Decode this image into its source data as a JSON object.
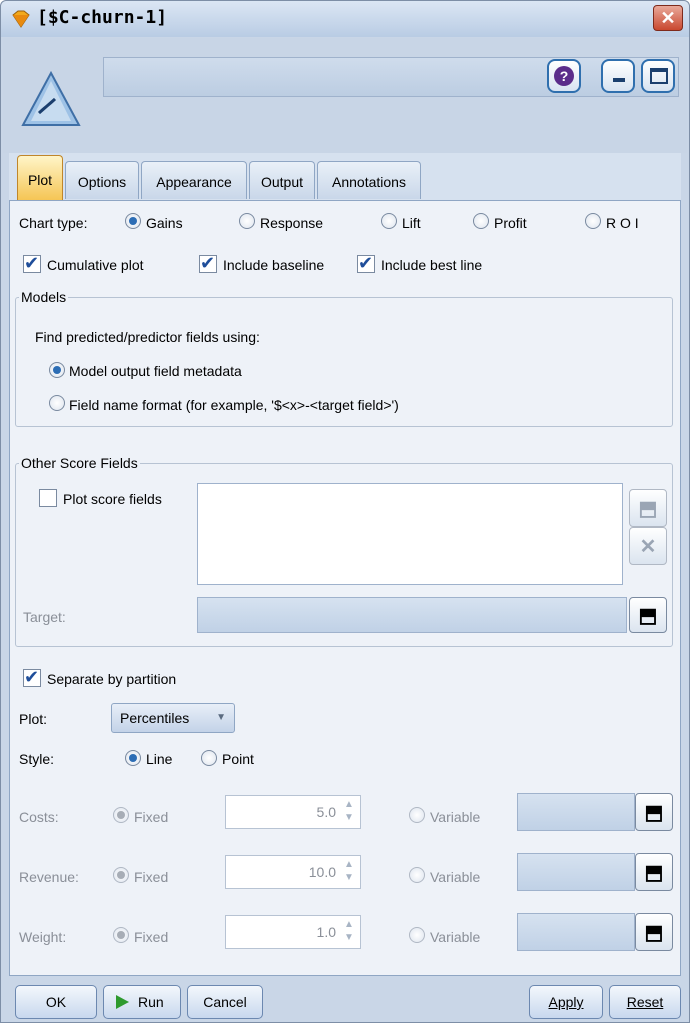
{
  "window": {
    "title": "[$C-churn-1]",
    "close_glyph": "✕"
  },
  "header": {
    "name_value": "",
    "help_glyph": "?"
  },
  "tabs": [
    {
      "label": "Plot"
    },
    {
      "label": "Options"
    },
    {
      "label": "Appearance"
    },
    {
      "label": "Output"
    },
    {
      "label": "Annotations"
    }
  ],
  "chart_type": {
    "label": "Chart type:",
    "options": [
      {
        "label": "Gains",
        "selected": true
      },
      {
        "label": "Response",
        "selected": false
      },
      {
        "label": "Lift",
        "selected": false
      },
      {
        "label": "Profit",
        "selected": false
      },
      {
        "label": "R O I",
        "selected": false
      }
    ]
  },
  "plot_checks": [
    {
      "label": "Cumulative plot",
      "checked": true
    },
    {
      "label": "Include baseline",
      "checked": true
    },
    {
      "label": "Include best line",
      "checked": true
    }
  ],
  "models": {
    "legend": "Models",
    "prompt": "Find predicted/predictor fields using:",
    "options": [
      {
        "label": "Model output field metadata",
        "selected": true
      },
      {
        "label": "Field name format (for example, '$<x>-<target field>')",
        "selected": false
      }
    ]
  },
  "other_scores": {
    "legend": "Other Score Fields",
    "plot_label": "Plot score fields",
    "plot_checked": false,
    "target_label": "Target:",
    "delete_glyph": "✕"
  },
  "separate": {
    "label": "Separate by partition",
    "checked": true
  },
  "plot_select": {
    "label": "Plot:",
    "value": "Percentiles",
    "caret": "▼"
  },
  "style": {
    "label": "Style:",
    "options": [
      {
        "label": "Line",
        "selected": true
      },
      {
        "label": "Point",
        "selected": false
      }
    ]
  },
  "costs_rows": [
    {
      "label": "Costs:",
      "fixed_label": "Fixed",
      "value": "5.0",
      "variable_label": "Variable"
    },
    {
      "label": "Revenue:",
      "fixed_label": "Fixed",
      "value": "10.0",
      "variable_label": "Variable"
    },
    {
      "label": "Weight:",
      "fixed_label": "Fixed",
      "value": "1.0",
      "variable_label": "Variable"
    }
  ],
  "spin_up": "▲",
  "spin_down": "▼",
  "field_picker_glyph": "⬒",
  "buttons": {
    "ok": "OK",
    "run": "Run",
    "cancel": "Cancel",
    "apply": "Apply",
    "reset": "Reset"
  },
  "colors": {
    "accent": "#2c6db5",
    "active_tab": "#f5c452",
    "run_green": "#2e9a2e"
  }
}
